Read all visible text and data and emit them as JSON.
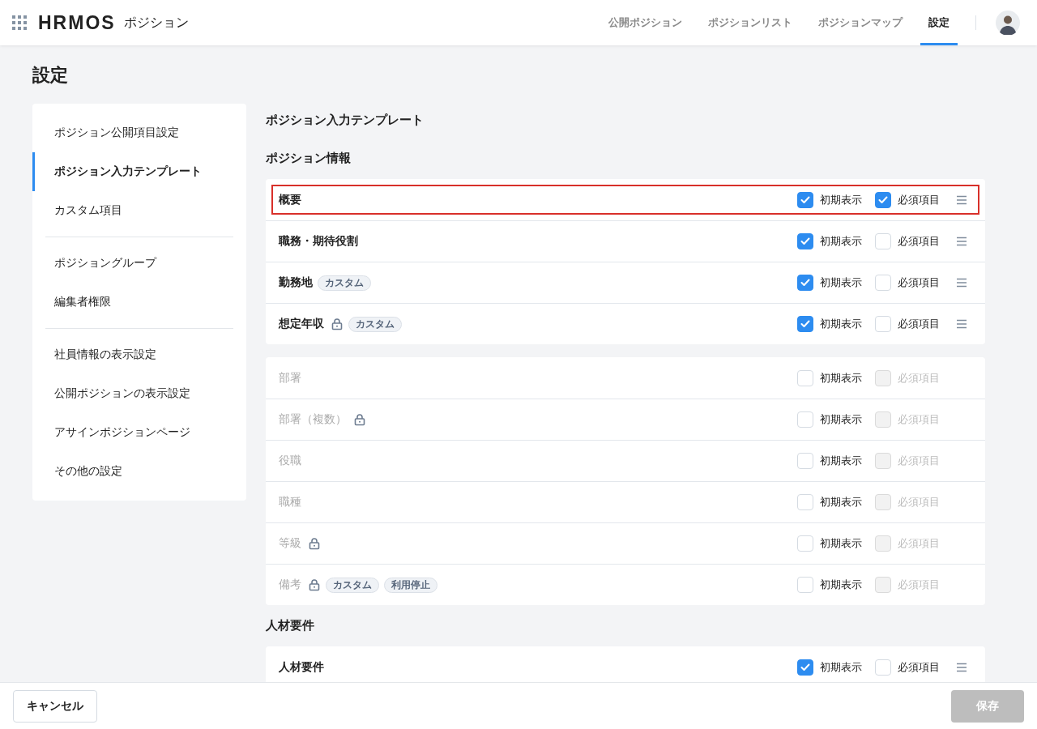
{
  "header": {
    "logo": "HRMOS",
    "product": "ポジション",
    "nav": [
      {
        "label": "公開ポジション",
        "selected": false
      },
      {
        "label": "ポジションリスト",
        "selected": false
      },
      {
        "label": "ポジションマップ",
        "selected": false
      },
      {
        "label": "設定",
        "selected": true
      }
    ]
  },
  "page_title": "設定",
  "sidebar": {
    "groups": [
      {
        "items": [
          {
            "label": "ポジション公開項目設定",
            "selected": false
          },
          {
            "label": "ポジション入力テンプレート",
            "selected": true
          },
          {
            "label": "カスタム項目",
            "selected": false
          }
        ]
      },
      {
        "items": [
          {
            "label": "ポジショングループ",
            "selected": false
          },
          {
            "label": "編集者権限",
            "selected": false
          }
        ]
      },
      {
        "items": [
          {
            "label": "社員情報の表示設定",
            "selected": false
          },
          {
            "label": "公開ポジションの表示設定",
            "selected": false
          },
          {
            "label": "アサインポジションページ",
            "selected": false
          },
          {
            "label": "その他の設定",
            "selected": false
          }
        ]
      }
    ]
  },
  "content": {
    "title": "ポジション入力テンプレート",
    "sections": [
      {
        "heading": "ポジション情報",
        "cards": [
          {
            "rows": [
              {
                "label": "概要",
                "locked": false,
                "tags": [],
                "enabled": true,
                "highlighted": true,
                "draggable": true,
                "initial": {
                  "label": "初期表示",
                  "checked": true
                },
                "required": {
                  "label": "必須項目",
                  "checked": true,
                  "disabled": false
                }
              },
              {
                "label": "職務・期待役割",
                "locked": false,
                "tags": [],
                "enabled": true,
                "highlighted": false,
                "draggable": true,
                "initial": {
                  "label": "初期表示",
                  "checked": true
                },
                "required": {
                  "label": "必須項目",
                  "checked": false,
                  "disabled": false
                }
              },
              {
                "label": "勤務地",
                "locked": false,
                "tags": [
                  "カスタム"
                ],
                "enabled": true,
                "highlighted": false,
                "draggable": true,
                "initial": {
                  "label": "初期表示",
                  "checked": true
                },
                "required": {
                  "label": "必須項目",
                  "checked": false,
                  "disabled": false
                }
              },
              {
                "label": "想定年収",
                "locked": true,
                "tags": [
                  "カスタム"
                ],
                "enabled": true,
                "highlighted": false,
                "draggable": true,
                "initial": {
                  "label": "初期表示",
                  "checked": true
                },
                "required": {
                  "label": "必須項目",
                  "checked": false,
                  "disabled": false
                }
              }
            ]
          },
          {
            "rows": [
              {
                "label": "部署",
                "locked": false,
                "tags": [],
                "enabled": false,
                "highlighted": false,
                "draggable": false,
                "initial": {
                  "label": "初期表示",
                  "checked": false
                },
                "required": {
                  "label": "必須項目",
                  "checked": false,
                  "disabled": true
                }
              },
              {
                "label": "部署（複数）",
                "locked": true,
                "tags": [],
                "enabled": false,
                "highlighted": false,
                "draggable": false,
                "initial": {
                  "label": "初期表示",
                  "checked": false
                },
                "required": {
                  "label": "必須項目",
                  "checked": false,
                  "disabled": true
                }
              },
              {
                "label": "役職",
                "locked": false,
                "tags": [],
                "enabled": false,
                "highlighted": false,
                "draggable": false,
                "initial": {
                  "label": "初期表示",
                  "checked": false
                },
                "required": {
                  "label": "必須項目",
                  "checked": false,
                  "disabled": true
                }
              },
              {
                "label": "職種",
                "locked": false,
                "tags": [],
                "enabled": false,
                "highlighted": false,
                "draggable": false,
                "initial": {
                  "label": "初期表示",
                  "checked": false
                },
                "required": {
                  "label": "必須項目",
                  "checked": false,
                  "disabled": true
                }
              },
              {
                "label": "等級",
                "locked": true,
                "tags": [],
                "enabled": false,
                "highlighted": false,
                "draggable": false,
                "initial": {
                  "label": "初期表示",
                  "checked": false
                },
                "required": {
                  "label": "必須項目",
                  "checked": false,
                  "disabled": true
                }
              },
              {
                "label": "備考",
                "locked": true,
                "tags": [
                  "カスタム",
                  "利用停止"
                ],
                "enabled": false,
                "highlighted": false,
                "draggable": false,
                "initial": {
                  "label": "初期表示",
                  "checked": false
                },
                "required": {
                  "label": "必須項目",
                  "checked": false,
                  "disabled": true
                }
              }
            ]
          }
        ]
      },
      {
        "heading": "人材要件",
        "cards": [
          {
            "rows": [
              {
                "label": "人材要件",
                "locked": false,
                "tags": [],
                "enabled": true,
                "highlighted": false,
                "draggable": true,
                "initial": {
                  "label": "初期表示",
                  "checked": true
                },
                "required": {
                  "label": "必須項目",
                  "checked": false,
                  "disabled": false
                }
              }
            ]
          }
        ]
      }
    ]
  },
  "footer": {
    "cancel": "キャンセル",
    "save": {
      "label": "保存",
      "disabled": true
    }
  }
}
